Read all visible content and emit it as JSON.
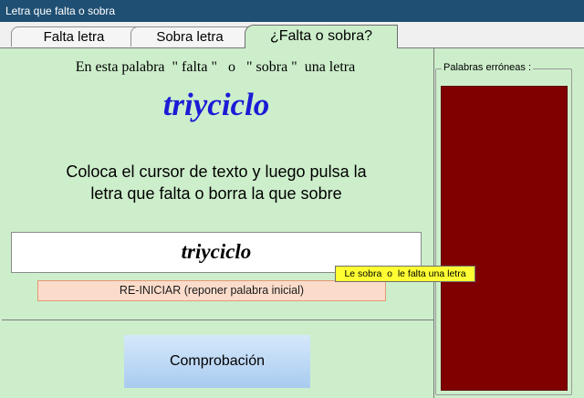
{
  "window": {
    "title": "Letra que falta o sobra"
  },
  "tabs": [
    {
      "label": "Falta letra"
    },
    {
      "label": "Sobra letra"
    },
    {
      "label": "¿Falta o sobra?"
    }
  ],
  "main": {
    "instruction_top": "En esta palabra  \" falta \"   o   \" sobra \"  una letra",
    "target_word": "triyciclo",
    "instruction_body": "Coloca el cursor de texto y luego pulsa la letra que falta o borra la que sobre",
    "input_value": "triyciclo",
    "reset_label": "RE-INICIAR  (reponer palabra inicial)",
    "tooltip": "Le sobra  o  le falta una letra",
    "check_label": "Comprobación"
  },
  "side": {
    "group_label": "Palabras erróneas :"
  },
  "colors": {
    "titlebar": "#1f4f73",
    "panel": "#cdeecb",
    "word": "#1c1cd6",
    "wrong_list": "#800000",
    "tooltip": "#ffff33"
  }
}
